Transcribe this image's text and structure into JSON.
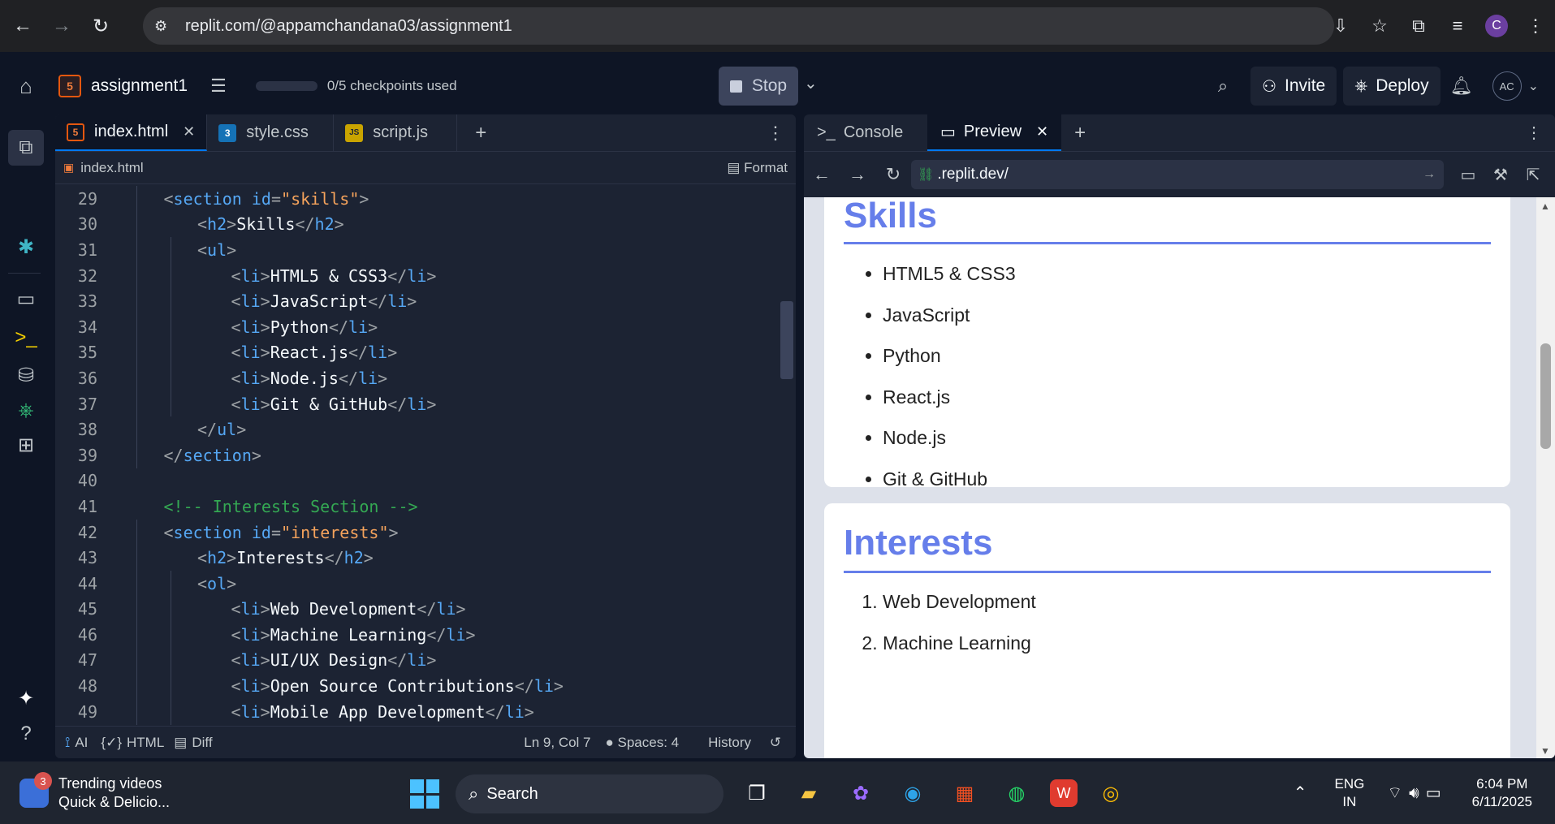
{
  "browser": {
    "url": "replit.com/@appamchandana03/assignment1",
    "profile_initial": "C"
  },
  "header": {
    "repl_name": "assignment1",
    "checkpoints": "0/5 checkpoints used",
    "stop_label": "Stop",
    "invite_label": "Invite",
    "deploy_label": "Deploy",
    "avatar": "AC"
  },
  "editor": {
    "tabs": [
      {
        "label": "index.html",
        "icon": "html5-icon",
        "active": true
      },
      {
        "label": "style.css",
        "icon": "css3-icon",
        "active": false
      },
      {
        "label": "script.js",
        "icon": "js-icon",
        "active": false
      }
    ],
    "breadcrumb": "index.html",
    "format_label": "Format",
    "lines": [
      {
        "n": "29",
        "indent": 1,
        "html": "<span class=\"t-punc\">&lt;</span><span class=\"t-tag\">section</span> <span class=\"t-attr\">id</span><span class=\"t-punc\">=</span><span class=\"t-str\">\"skills\"</span><span class=\"t-punc\">&gt;</span>"
      },
      {
        "n": "30",
        "indent": 2,
        "html": "<span class=\"t-punc\">&lt;</span><span class=\"t-tag\">h2</span><span class=\"t-punc\">&gt;</span><span class=\"t-txt\">Skills</span><span class=\"t-punc\">&lt;/</span><span class=\"t-tag\">h2</span><span class=\"t-punc\">&gt;</span>"
      },
      {
        "n": "31",
        "indent": 2,
        "html": "<span class=\"t-punc\">&lt;</span><span class=\"t-tag\">ul</span><span class=\"t-punc\">&gt;</span>"
      },
      {
        "n": "32",
        "indent": 3,
        "html": "<span class=\"t-punc\">&lt;</span><span class=\"t-tag\">li</span><span class=\"t-punc\">&gt;</span><span class=\"t-txt\">HTML5 &amp; CSS3</span><span class=\"t-punc\">&lt;/</span><span class=\"t-tag\">li</span><span class=\"t-punc\">&gt;</span>"
      },
      {
        "n": "33",
        "indent": 3,
        "html": "<span class=\"t-punc\">&lt;</span><span class=\"t-tag\">li</span><span class=\"t-punc\">&gt;</span><span class=\"t-txt\">JavaScript</span><span class=\"t-punc\">&lt;/</span><span class=\"t-tag\">li</span><span class=\"t-punc\">&gt;</span>"
      },
      {
        "n": "34",
        "indent": 3,
        "html": "<span class=\"t-punc\">&lt;</span><span class=\"t-tag\">li</span><span class=\"t-punc\">&gt;</span><span class=\"t-txt\">Python</span><span class=\"t-punc\">&lt;/</span><span class=\"t-tag\">li</span><span class=\"t-punc\">&gt;</span>"
      },
      {
        "n": "35",
        "indent": 3,
        "html": "<span class=\"t-punc\">&lt;</span><span class=\"t-tag\">li</span><span class=\"t-punc\">&gt;</span><span class=\"t-txt\">React.js</span><span class=\"t-punc\">&lt;/</span><span class=\"t-tag\">li</span><span class=\"t-punc\">&gt;</span>"
      },
      {
        "n": "36",
        "indent": 3,
        "html": "<span class=\"t-punc\">&lt;</span><span class=\"t-tag\">li</span><span class=\"t-punc\">&gt;</span><span class=\"t-txt\">Node.js</span><span class=\"t-punc\">&lt;/</span><span class=\"t-tag\">li</span><span class=\"t-punc\">&gt;</span>"
      },
      {
        "n": "37",
        "indent": 3,
        "html": "<span class=\"t-punc\">&lt;</span><span class=\"t-tag\">li</span><span class=\"t-punc\">&gt;</span><span class=\"t-txt\">Git &amp; GitHub</span><span class=\"t-punc\">&lt;/</span><span class=\"t-tag\">li</span><span class=\"t-punc\">&gt;</span>"
      },
      {
        "n": "38",
        "indent": 2,
        "html": "<span class=\"t-punc\">&lt;/</span><span class=\"t-tag\">ul</span><span class=\"t-punc\">&gt;</span>"
      },
      {
        "n": "39",
        "indent": 1,
        "html": "<span class=\"t-punc\">&lt;/</span><span class=\"t-tag\">section</span><span class=\"t-punc\">&gt;</span>"
      },
      {
        "n": "40",
        "indent": 0,
        "html": ""
      },
      {
        "n": "41",
        "indent": 1,
        "html": "<span class=\"t-com\">&lt;!-- Interests Section --&gt;</span>"
      },
      {
        "n": "42",
        "indent": 1,
        "html": "<span class=\"t-punc\">&lt;</span><span class=\"t-tag\">section</span> <span class=\"t-attr\">id</span><span class=\"t-punc\">=</span><span class=\"t-str\">\"interests\"</span><span class=\"t-punc\">&gt;</span>"
      },
      {
        "n": "43",
        "indent": 2,
        "html": "<span class=\"t-punc\">&lt;</span><span class=\"t-tag\">h2</span><span class=\"t-punc\">&gt;</span><span class=\"t-txt\">Interests</span><span class=\"t-punc\">&lt;/</span><span class=\"t-tag\">h2</span><span class=\"t-punc\">&gt;</span>"
      },
      {
        "n": "44",
        "indent": 2,
        "html": "<span class=\"t-punc\">&lt;</span><span class=\"t-tag\">ol</span><span class=\"t-punc\">&gt;</span>"
      },
      {
        "n": "45",
        "indent": 3,
        "html": "<span class=\"t-punc\">&lt;</span><span class=\"t-tag\">li</span><span class=\"t-punc\">&gt;</span><span class=\"t-txt\">Web Development</span><span class=\"t-punc\">&lt;/</span><span class=\"t-tag\">li</span><span class=\"t-punc\">&gt;</span>"
      },
      {
        "n": "46",
        "indent": 3,
        "html": "<span class=\"t-punc\">&lt;</span><span class=\"t-tag\">li</span><span class=\"t-punc\">&gt;</span><span class=\"t-txt\">Machine Learning</span><span class=\"t-punc\">&lt;/</span><span class=\"t-tag\">li</span><span class=\"t-punc\">&gt;</span>"
      },
      {
        "n": "47",
        "indent": 3,
        "html": "<span class=\"t-punc\">&lt;</span><span class=\"t-tag\">li</span><span class=\"t-punc\">&gt;</span><span class=\"t-txt\">UI/UX Design</span><span class=\"t-punc\">&lt;/</span><span class=\"t-tag\">li</span><span class=\"t-punc\">&gt;</span>"
      },
      {
        "n": "48",
        "indent": 3,
        "html": "<span class=\"t-punc\">&lt;</span><span class=\"t-tag\">li</span><span class=\"t-punc\">&gt;</span><span class=\"t-txt\">Open Source Contributions</span><span class=\"t-punc\">&lt;/</span><span class=\"t-tag\">li</span><span class=\"t-punc\">&gt;</span>"
      },
      {
        "n": "49",
        "indent": 3,
        "html": "<span class=\"t-punc\">&lt;</span><span class=\"t-tag\">li</span><span class=\"t-punc\">&gt;</span><span class=\"t-txt\">Mobile App Development</span><span class=\"t-punc\">&lt;/</span><span class=\"t-tag\">li</span><span class=\"t-punc\">&gt;</span>"
      }
    ],
    "status": {
      "ai": "AI",
      "lang": "HTML",
      "diff": "Diff",
      "position": "Ln 9, Col 7",
      "spaces": "Spaces: 4",
      "history": "History"
    }
  },
  "preview_pane": {
    "tabs": [
      {
        "label": "Console",
        "active": false
      },
      {
        "label": "Preview",
        "active": true
      }
    ],
    "url": ".replit.dev/",
    "skills": {
      "heading": "Skills",
      "items": [
        "HTML5 & CSS3",
        "JavaScript",
        "Python",
        "React.js",
        "Node.js",
        "Git & GitHub"
      ]
    },
    "interests": {
      "heading": "Interests",
      "items": [
        "Web Development",
        "Machine Learning"
      ]
    }
  },
  "taskbar": {
    "widget_title": "Trending videos",
    "widget_sub": "Quick & Delicio...",
    "widget_badge": "3",
    "search_label": "Search",
    "lang_top": "ENG",
    "lang_bottom": "IN",
    "time": "6:04 PM",
    "date": "6/11/2025"
  }
}
